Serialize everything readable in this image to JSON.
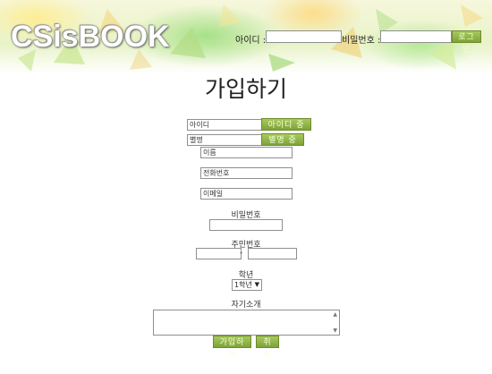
{
  "header": {
    "logo_text": "CSisBOOK",
    "id_label": "아이디 :",
    "password_label": "비밀번호 :",
    "login_button": "로그인"
  },
  "page_title": "가입하기",
  "form": {
    "id_field_value": "아이디",
    "id_check_button": "아이디 중복",
    "nickname_field_value": "별명",
    "nickname_check_button": "별명 중복",
    "name_field_value": "이름",
    "phone_field_value": "전화번호",
    "email_field_value": "이메일",
    "password_label": "비밀번호",
    "resident_number_label": "주민번호",
    "resident_number_separator": "-",
    "grade_label": "학년",
    "grade_selected": "1학년",
    "intro_label": "자기소개",
    "submit_button": "가입하기",
    "cancel_button": "취소"
  },
  "colors": {
    "button_green": "#8fb24a",
    "button_text": "#f4ffd8"
  }
}
